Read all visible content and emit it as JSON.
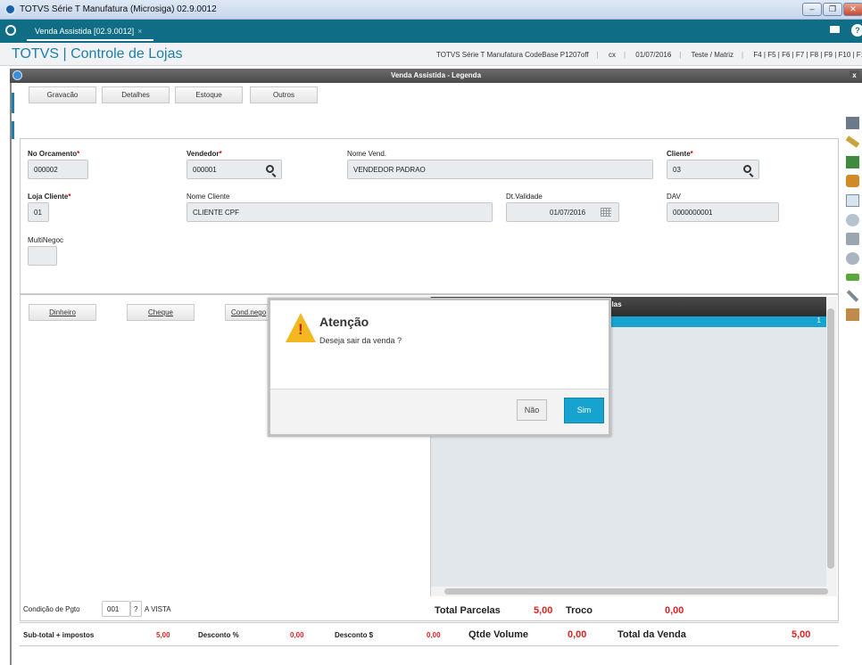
{
  "window": {
    "title": "TOTVS Série T Manufatura (Microsiga) 02.9.0012",
    "minimize": "–",
    "restore": "❐",
    "close": "✕"
  },
  "tab": {
    "label": "Venda Assistida [02.9.0012]",
    "close": "×",
    "help": "?"
  },
  "header": {
    "brand": "TOTVS | Controle de Lojas",
    "environment": "TOTVS Série T Manufatura CodeBase P1207off",
    "user": "cx",
    "date": "01/07/2016",
    "company": "Teste / Matriz",
    "shortcuts": "F4 | F5 | F6 | F7 | F8 | F9 | F10 | F11 | F12"
  },
  "dialog": {
    "title": "Venda Assistida - Legenda",
    "close": "x"
  },
  "toolbar": {
    "gravacao": "Gravacão",
    "detalhes": "Detalhes",
    "estoque": "Estoque",
    "outros": "Outros"
  },
  "form": {
    "no_orcamento": {
      "label": "No Orcamento",
      "value": "000002"
    },
    "vendedor": {
      "label": "Vendedor",
      "value": "000001"
    },
    "nome_vend": {
      "label": "Nome Vend.",
      "value": "VENDEDOR PADRAO"
    },
    "cliente": {
      "label": "Cliente",
      "value": "03"
    },
    "loja_cliente": {
      "label": "Loja Cliente",
      "value": "01"
    },
    "nome_cliente": {
      "label": "Nome Cliente",
      "value": "CLIENTE CPF"
    },
    "dt_validade": {
      "label": "Dt.Validade",
      "value": "01/07/2016"
    },
    "dav": {
      "label": "DAV",
      "value": "0000000001"
    },
    "multinegoc": {
      "label": "MultiNegoc",
      "value": ""
    },
    "required_mark": "*"
  },
  "payment": {
    "dinheiro": "Dinheiro",
    "cheque": "Cheque",
    "cond_neg": "Cond.nego"
  },
  "grid": {
    "header": "elas",
    "row_value": "1"
  },
  "condicao": {
    "label": "Condição de Pgto",
    "code": "001",
    "q": "?",
    "desc": "A VISTA"
  },
  "totals": {
    "total_parcelas_label": "Total Parcelas",
    "total_parcelas": "5,00",
    "troco_label": "Troco",
    "troco": "0,00",
    "subtotal_label": "Sub-total + impostos",
    "subtotal": "5,00",
    "desc_pct_label": "Desconto %",
    "desc_pct": "0,00",
    "desc_val_label": "Desconto $",
    "desc_val": "0,00",
    "qtde_label": "Qtde Volume",
    "qtde": "0,00",
    "total_venda_label": "Total da Venda",
    "total_venda": "5,00"
  },
  "modal": {
    "title": "Atenção",
    "message": "Deseja sair da venda ?",
    "no": "Não",
    "yes": "Sim",
    "excl": "!"
  },
  "colors": {
    "teal": "#0f6e86",
    "accent": "#17a3d0",
    "brand": "#1f7ea8",
    "required": "#dd0000",
    "value_red": "#d22222"
  }
}
